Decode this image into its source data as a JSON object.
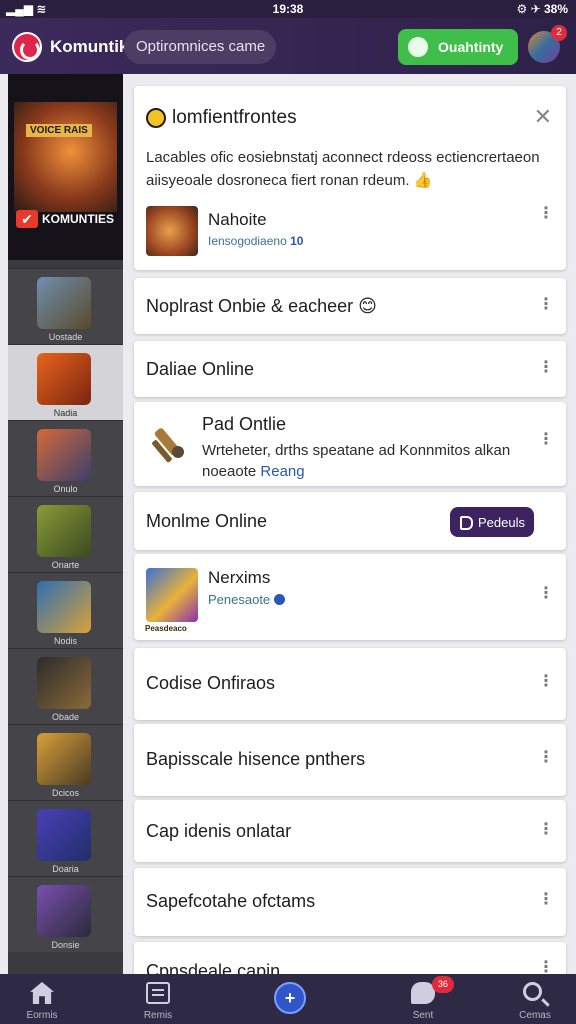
{
  "status_bar": {
    "time": "19:38",
    "battery": "38%"
  },
  "header": {
    "app_name": "Komuntik",
    "search_placeholder": "Optiromnices came",
    "action_label": "Ouahtinty",
    "notification_count": "2"
  },
  "sidebar": {
    "featured": {
      "art_title": "VOICE RAIS",
      "game_name": "KOMUNTIES"
    },
    "items": [
      {
        "label": "Uostade",
        "colors": [
          "#6f8fb0",
          "#5a4a2a"
        ]
      },
      {
        "label": "Nadia",
        "colors": [
          "#e8641c",
          "#7a2410"
        ]
      },
      {
        "label": "Onulo",
        "colors": [
          "#d46a3a",
          "#3b3f6a"
        ]
      },
      {
        "label": "Onarte",
        "colors": [
          "#8a9b3a",
          "#3a4a20"
        ]
      },
      {
        "label": "Nodis",
        "colors": [
          "#2d6fb0",
          "#d8a23a"
        ]
      },
      {
        "label": "Obade",
        "colors": [
          "#2b2b2b",
          "#8b6a3a"
        ]
      },
      {
        "label": "Dcicos",
        "colors": [
          "#d9a03a",
          "#4a3a22"
        ]
      },
      {
        "label": "Doaria",
        "colors": [
          "#4b3fb8",
          "#1f2f6a"
        ]
      },
      {
        "label": "Donsie",
        "colors": [
          "#7a4fb0",
          "#2a2a3a"
        ]
      }
    ]
  },
  "hero": {
    "title": "lomfientfrontes",
    "description": "Lacables ofic eosiebnstatj aconnect rdeoss ectiencrertaeon aiisyeoale dosroneca fiert ronan rdeum. 👍",
    "sub_title": "Nahoite",
    "sub_meta": "Iensogodiaeno",
    "sub_meta_count": "10"
  },
  "rows": {
    "r1": "Noplrast Onbie & eacheer 😊",
    "r2": "Daliae Online",
    "r3_title": "Pad Ontlie",
    "r3_desc": "Wrteheter, drths speatane ad Konnmitos alkan noeaote",
    "r3_link": "Reang",
    "r4": "Monlme Online",
    "r4_button": "Pedeuls",
    "r5_title": "Nerxims",
    "r5_meta": "Penesaote",
    "r5_thumb_caption": "Peasdeaco",
    "r6": "Codise Onfiraos",
    "r7": "Bapisscale hisence pnthers",
    "r8": "Cap idenis onlatar",
    "r9": "Sapefcotahe ofctams",
    "r10": "Cpnsdeale capin"
  },
  "bottom_nav": {
    "home": "Eormis",
    "list": "Remis",
    "center": "+",
    "chat": "Sent",
    "chat_badge": "36",
    "search": "Cemas"
  }
}
